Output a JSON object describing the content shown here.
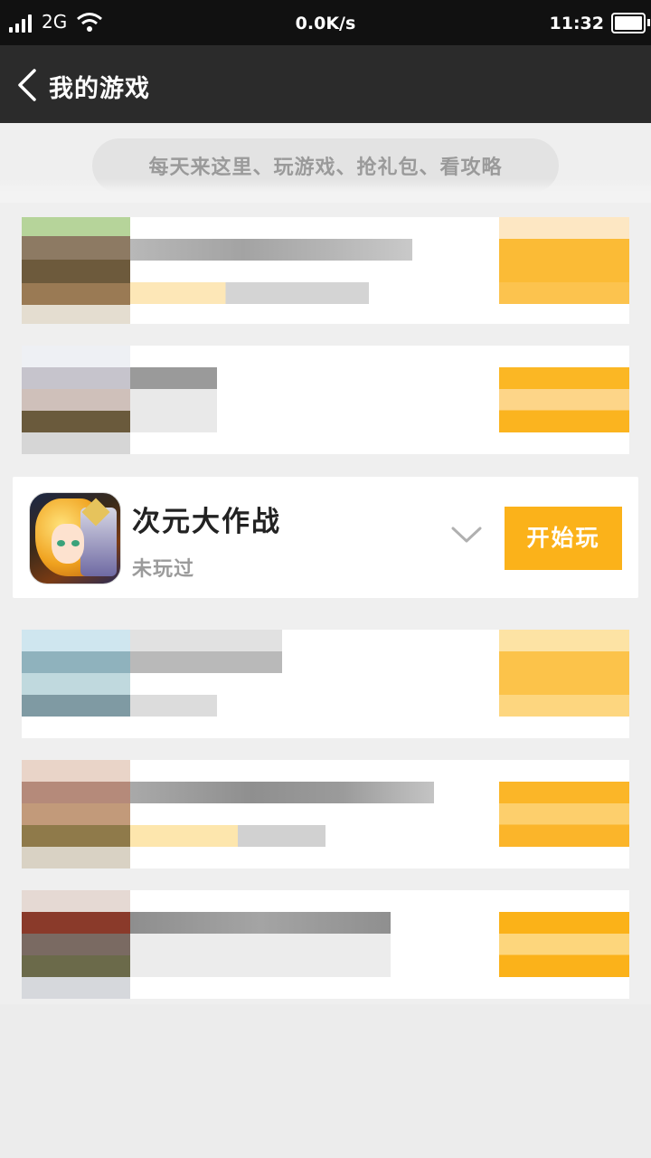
{
  "status_bar": {
    "network_type": "2G",
    "speed": "0.0K/s",
    "time": "11:32"
  },
  "header": {
    "title": "我的游戏"
  },
  "banner": {
    "slogan": "每天来这里、玩游戏、抢礼包、看攻略"
  },
  "featured_game": {
    "name": "次元大作战",
    "status": "未玩过",
    "play_label": "开始玩"
  },
  "colors": {
    "accent": "#fbb21a",
    "header_bg": "#2b2b2b",
    "page_bg": "#efefef"
  }
}
